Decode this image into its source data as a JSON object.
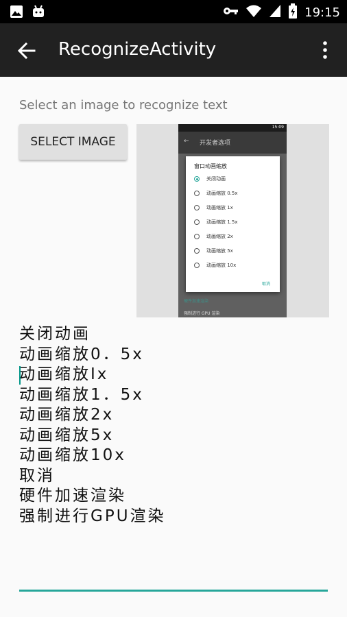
{
  "status_bar": {
    "time": "19:15",
    "left_icons": [
      "image-notification-icon",
      "android-notification-icon"
    ],
    "right_icons": [
      "key-icon",
      "wifi-icon",
      "signal-icon",
      "battery-charging-icon"
    ]
  },
  "app_bar": {
    "title": "RecognizeActivity",
    "back_icon": "arrow-back-icon",
    "menu_icon": "more-vert-icon"
  },
  "hint": "Select an image to recognize text",
  "select_button": "SELECT IMAGE",
  "preview": {
    "status_time": "15:09",
    "toolbar_title": "开发者选项",
    "dialog_title": "窗口动画缩放",
    "options": [
      "关闭动画",
      "动画缩放 0.5x",
      "动画缩放 1x",
      "动画缩放 1.5x",
      "动画缩放 2x",
      "动画缩放 5x",
      "动画缩放 10x"
    ],
    "selected_index": 0,
    "cancel": "取消",
    "bottom_1": "硬件加速渲染",
    "bottom_2": "强制进行 GPU 渲染"
  },
  "recognized_lines": [
    "关闭动画",
    "动画缩放0．5x",
    "动画缩放Ix",
    "动画缩放1．5x",
    "动画缩放2x",
    "动画缩放5x",
    "动画缩放10x",
    "取消",
    "硬件加速渲染",
    "强制进行GPU渲染"
  ],
  "colors": {
    "accent": "#26a69a",
    "app_bar": "#212121",
    "status_bar": "#000000"
  }
}
